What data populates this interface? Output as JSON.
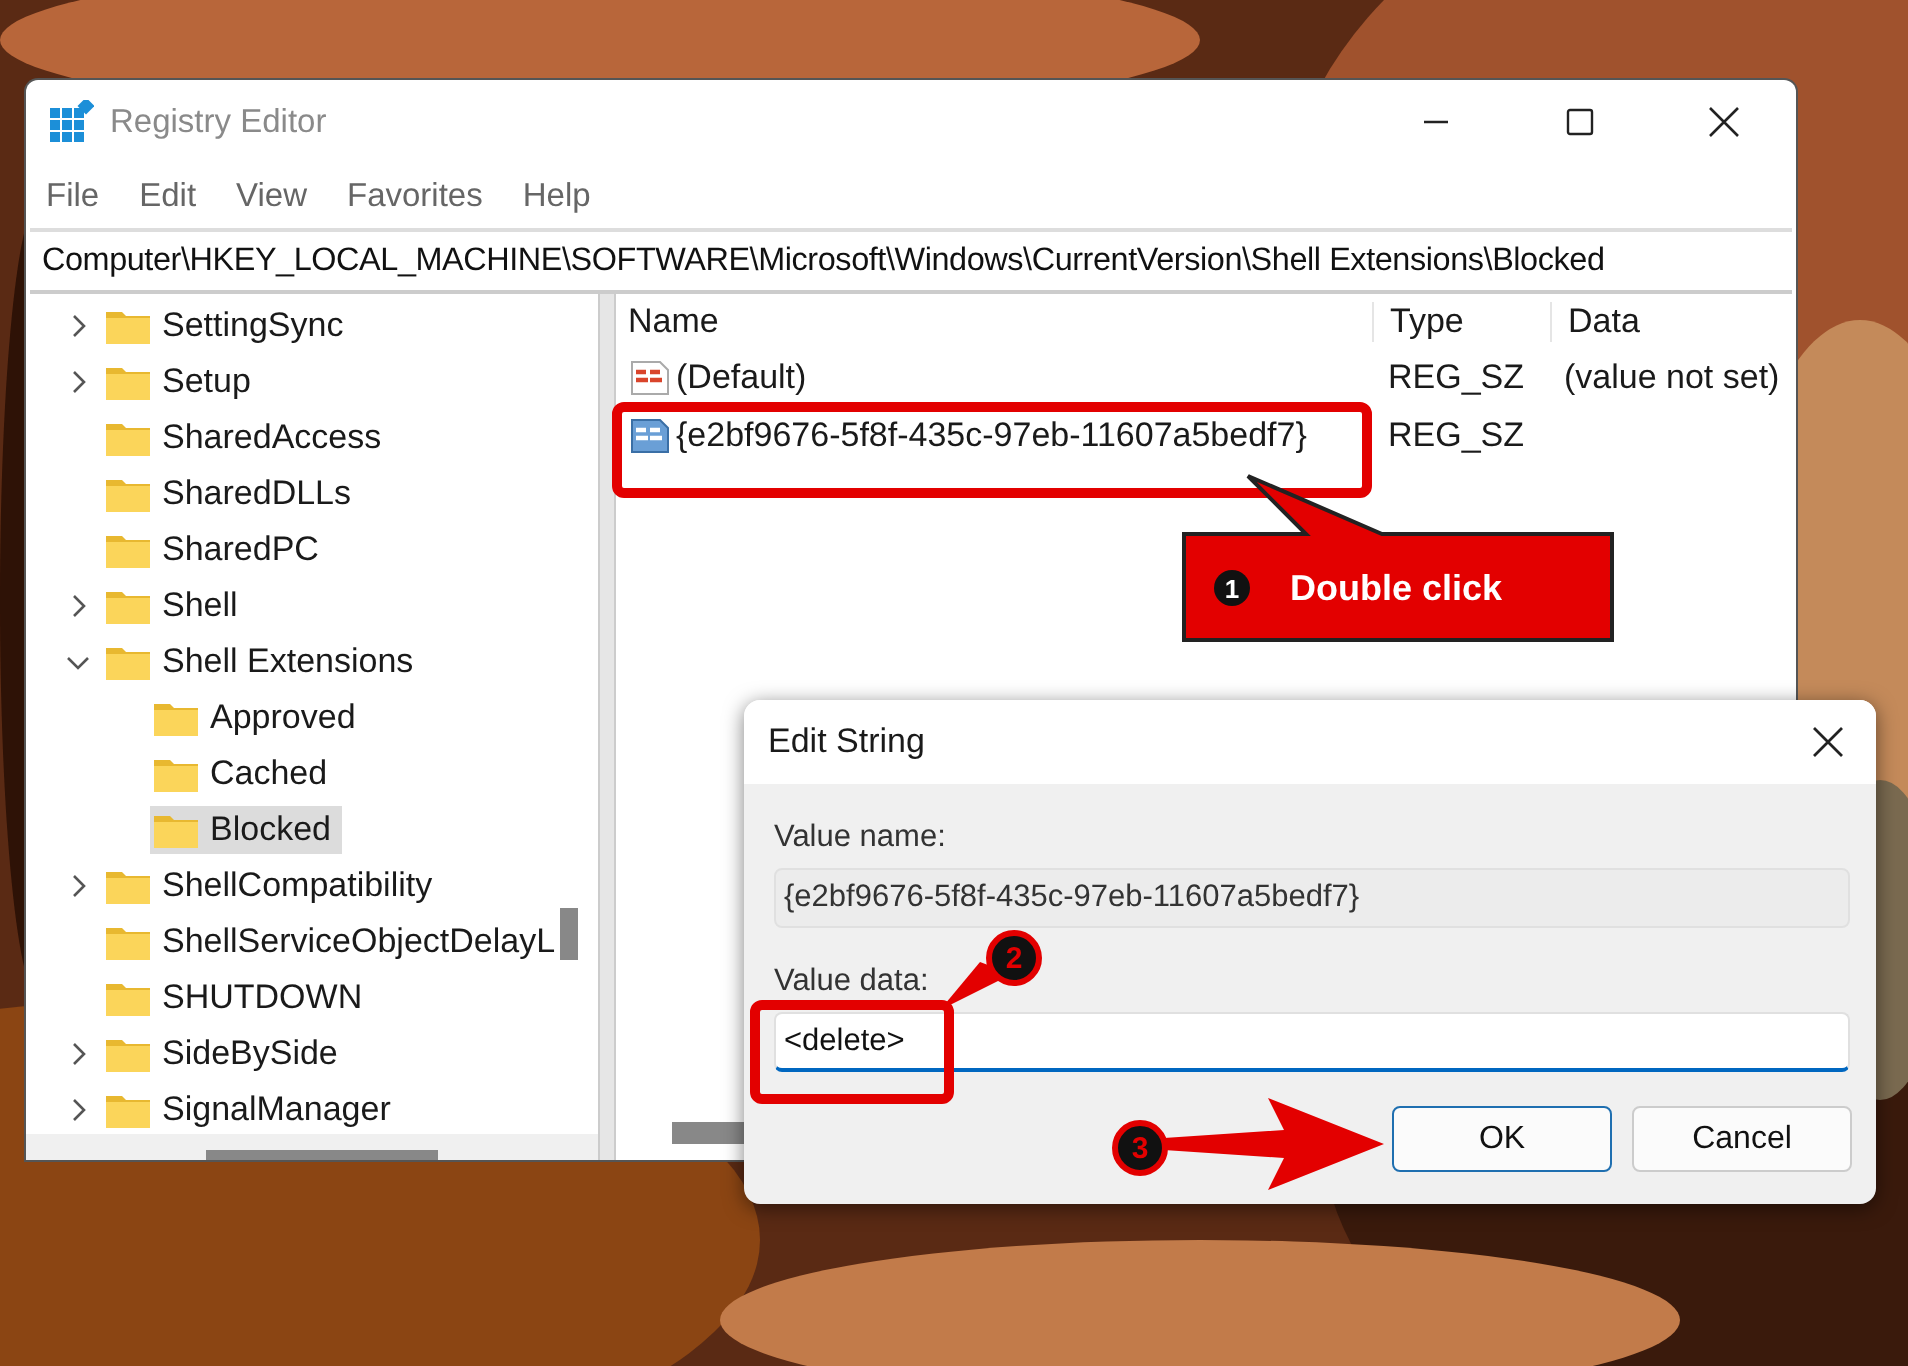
{
  "window": {
    "title": "Registry Editor"
  },
  "menu": [
    "File",
    "Edit",
    "View",
    "Favorites",
    "Help"
  ],
  "address": "Computer\\HKEY_LOCAL_MACHINE\\SOFTWARE\\Microsoft\\Windows\\CurrentVersion\\Shell Extensions\\Blocked",
  "tree": [
    {
      "label": "SettingSync",
      "expanded": false,
      "selected": false
    },
    {
      "label": "Setup",
      "expanded": false,
      "selected": false
    },
    {
      "label": "SharedAccess",
      "selected": false
    },
    {
      "label": "SharedDLLs",
      "selected": false
    },
    {
      "label": "SharedPC",
      "selected": false
    },
    {
      "label": "Shell",
      "expanded": false,
      "selected": false
    },
    {
      "label": "Shell Extensions",
      "expanded": true,
      "selected": false,
      "children": [
        {
          "label": "Approved",
          "selected": false
        },
        {
          "label": "Cached",
          "selected": false
        },
        {
          "label": "Blocked",
          "selected": true
        }
      ]
    },
    {
      "label": "ShellCompatibility",
      "expanded": false,
      "selected": false
    },
    {
      "label": "ShellServiceObjectDelayL",
      "selected": false
    },
    {
      "label": "SHUTDOWN",
      "selected": false
    },
    {
      "label": "SideBySide",
      "expanded": false,
      "selected": false
    },
    {
      "label": "SignalManager",
      "expanded": false,
      "selected": false
    }
  ],
  "values": {
    "columns": [
      "Name",
      "Type",
      "Data"
    ],
    "rows": [
      {
        "name": "(Default)",
        "type": "REG_SZ",
        "data": "(value not set)",
        "selected": false
      },
      {
        "name": "{e2bf9676-5f8f-435c-97eb-11607a5bedf7}",
        "type": "REG_SZ",
        "selected": true
      }
    ]
  },
  "dialog": {
    "title": "Edit String",
    "name_label": "Value name:",
    "name_value": "{e2bf9676-5f8f-435c-97eb-11607a5bedf7}",
    "data_label": "Value data:",
    "data_value": "<delete>",
    "buttons": [
      {
        "label": "OK",
        "default": true
      },
      {
        "label": "Cancel",
        "default": false
      }
    ]
  },
  "annotations": [
    {
      "number": "1",
      "text": "Double click"
    },
    {
      "number": "2"
    },
    {
      "number": "3"
    }
  ]
}
